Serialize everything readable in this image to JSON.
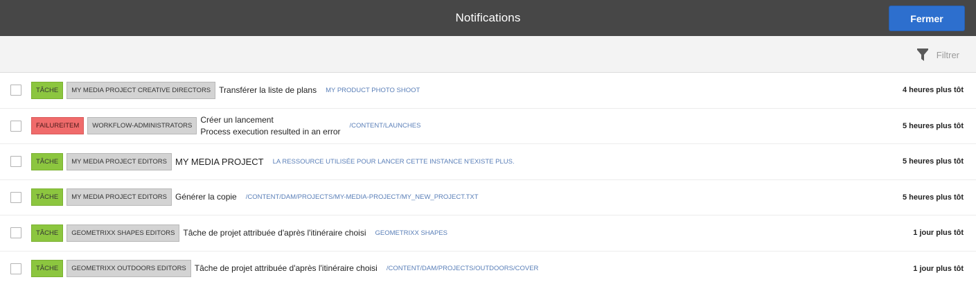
{
  "header": {
    "title": "Notifications",
    "close_label": "Fermer"
  },
  "toolbar": {
    "filter_label": "Filtrer",
    "filter_icon": "funnel-icon"
  },
  "colors": {
    "header_bg": "#474747",
    "close_bg": "#2d6fce",
    "task_badge": "#8cc63f",
    "failure_badge": "#f06b6b",
    "group_badge": "#d3d3d3",
    "path_text": "#5a7fb8"
  },
  "notifications": [
    {
      "type": "TÂCHE",
      "group": "MY MEDIA PROJECT CREATIVE DIRECTORS",
      "title": "Transférer la liste de plans",
      "path": "MY PRODUCT PHOTO SHOOT",
      "time": "4 heures plus tôt"
    },
    {
      "type": "FAILUREITEM",
      "group": "WORKFLOW-ADMINISTRATORS",
      "title": "Créer un lancement",
      "subtitle": "Process execution resulted in an error",
      "path": "/CONTENT/LAUNCHES",
      "time": "5 heures plus tôt"
    },
    {
      "type": "TÂCHE",
      "group": "MY MEDIA PROJECT EDITORS",
      "title": "MY MEDIA PROJECT",
      "path": "LA RESSOURCE UTILISÉE POUR LANCER CETTE INSTANCE N'EXISTE PLUS.",
      "time": "5 heures plus tôt"
    },
    {
      "type": "TÂCHE",
      "group": "MY MEDIA PROJECT EDITORS",
      "title": "Générer la copie",
      "path": "/CONTENT/DAM/PROJECTS/MY-MEDIA-PROJECT/MY_NEW_PROJECT.TXT",
      "time": "5 heures plus tôt"
    },
    {
      "type": "TÂCHE",
      "group": "GEOMETRIXX SHAPES EDITORS",
      "title": "Tâche de projet attribuée d'après l'itinéraire choisi",
      "path": "GEOMETRIXX SHAPES",
      "time": "1 jour plus tôt"
    },
    {
      "type": "TÂCHE",
      "group": "GEOMETRIXX OUTDOORS EDITORS",
      "title": "Tâche de projet attribuée d'après l'itinéraire choisi",
      "path": "/CONTENT/DAM/PROJECTS/OUTDOORS/COVER",
      "time": "1 jour plus tôt"
    }
  ]
}
